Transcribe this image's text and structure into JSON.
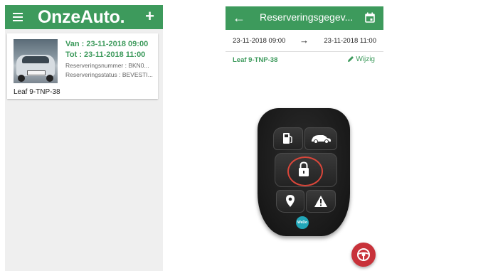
{
  "left_app": {
    "brand": "OnzeAuto.",
    "reservation_card": {
      "van": "Van : 23-11-2018 09:00",
      "tot": "Tot : 23-11-2018 11:00",
      "reserveringsnummer": "Reserveringsnummer : BKN0...",
      "reserveringsstatus": "Reserveringsstatus : BEVESTI...",
      "car_label": "Leaf 9-TNP-38"
    }
  },
  "right_app": {
    "title": "Reserveringsgegev...",
    "from": "23-11-2018 09:00",
    "to": "23-11-2018 11:00",
    "car": "Leaf 9-TNP-38",
    "edit_label": "Wijzig",
    "fob": {
      "badge": "WeDo"
    }
  },
  "colors": {
    "primary": "#3d9a5c",
    "lock_ring": "#d9463a",
    "fab": "#c8323a"
  },
  "icons": [
    "menu-icon",
    "plus-icon",
    "back-arrow-icon",
    "calendar-icon",
    "edit-pencil-icon",
    "fuel-icon",
    "car-icon",
    "lock-icon",
    "location-pin-icon",
    "warning-icon",
    "steering-wheel-icon"
  ]
}
